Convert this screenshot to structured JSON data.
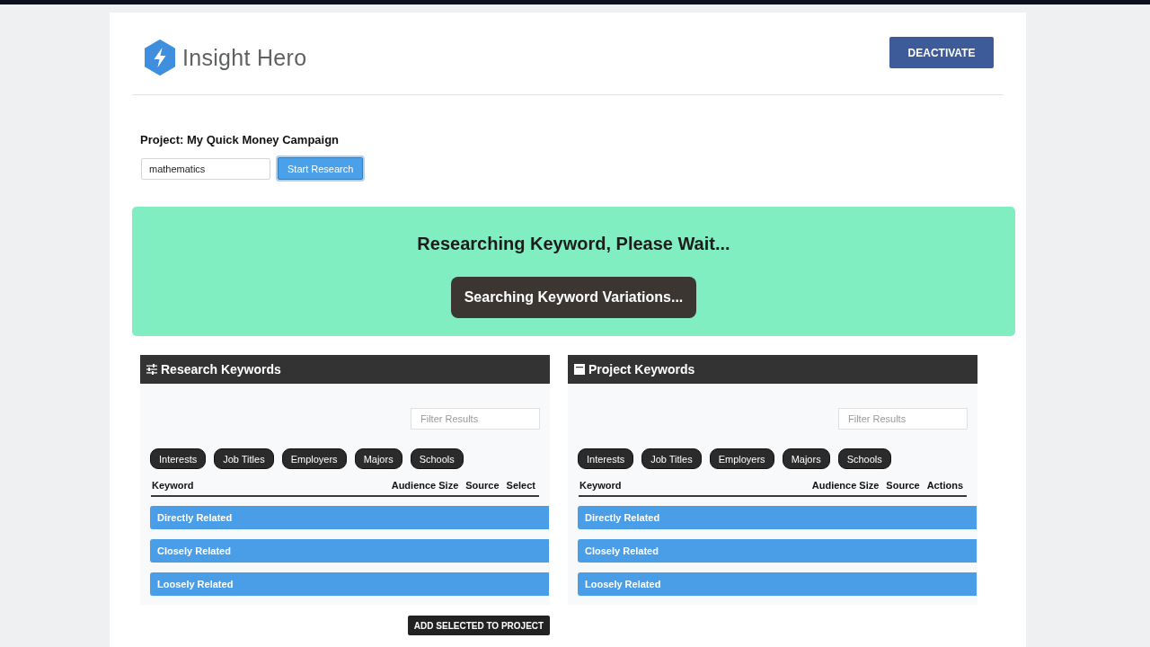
{
  "header": {
    "brand": "Insight Hero",
    "deactivate_button": "DEACTIVATE"
  },
  "project": {
    "label": "Project: My Quick Money Campaign",
    "search_field": {
      "value": "mathematics"
    },
    "start_button": {
      "label": "Start Research",
      "focused": true
    }
  },
  "status_banner": {
    "title": "Researching Keyword, Please Wait...",
    "status": "Searching Keyword Variations..."
  },
  "panels": [
    {
      "kind": "research",
      "title": "Research Keywords",
      "filter": {
        "placeholder": "Filter Results"
      },
      "chips": [
        "Interests",
        "Job Titles",
        "Employers",
        "Majors",
        "Schools"
      ],
      "columns": [
        "Keyword",
        "Audience Size",
        "Source",
        "Select"
      ],
      "groups": [
        "Directly Related",
        "Closely Related",
        "Loosely Related"
      ],
      "footer_button": "ADD SELECTED TO PROJECT"
    },
    {
      "kind": "project",
      "title": "Project Keywords",
      "filter": {
        "placeholder": "Filter Results"
      },
      "chips": [
        "Interests",
        "Job Titles",
        "Employers",
        "Majors",
        "Schools"
      ],
      "columns": [
        "Keyword",
        "Audience Size",
        "Source",
        "Actions"
      ],
      "groups": [
        "Directly Related",
        "Closely Related",
        "Loosely Related"
      ]
    }
  ]
}
